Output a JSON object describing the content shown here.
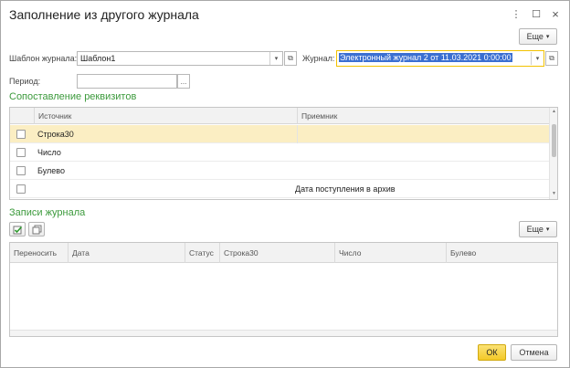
{
  "window": {
    "title": "Заполнение из другого журнала",
    "more_icon": "⋮",
    "maximize_icon": "☐",
    "close_icon": "×"
  },
  "toolbar": {
    "more_label": "Еще"
  },
  "form": {
    "template_label": "Шаблон журнала:",
    "template_value": "Шаблон1",
    "journal_label": "Журнал:",
    "journal_value": "Электронный журнал 2 от 11.03.2021 0:00:00",
    "period_label": "Период:",
    "period_value": "",
    "select_icon": "...",
    "dropdown_icon": "▾",
    "open_icon": "⧉"
  },
  "mapping": {
    "title": "Сопоставление реквизитов",
    "columns": [
      "Источник",
      "Приемник"
    ],
    "rows": [
      {
        "checked": false,
        "source": "Строка30",
        "target": "",
        "selected": true
      },
      {
        "checked": false,
        "source": "Число",
        "target": "",
        "selected": false
      },
      {
        "checked": false,
        "source": "Булево",
        "target": "",
        "selected": false
      },
      {
        "checked": false,
        "source": "",
        "target": "Дата поступления в архив",
        "selected": false
      }
    ]
  },
  "records": {
    "title": "Записи журнала",
    "more_label": "Еще",
    "columns": [
      "Переносить",
      "Дата",
      "Статус",
      "Строка30",
      "Число",
      "Булево"
    ],
    "rows": []
  },
  "footer": {
    "ok_label": "ОК",
    "cancel_label": "Отмена"
  },
  "colors": {
    "section": "#3c9a3c",
    "selected_row": "#fbeec3",
    "ok_button": "#f7d54a",
    "focus_border": "#f2c200"
  }
}
